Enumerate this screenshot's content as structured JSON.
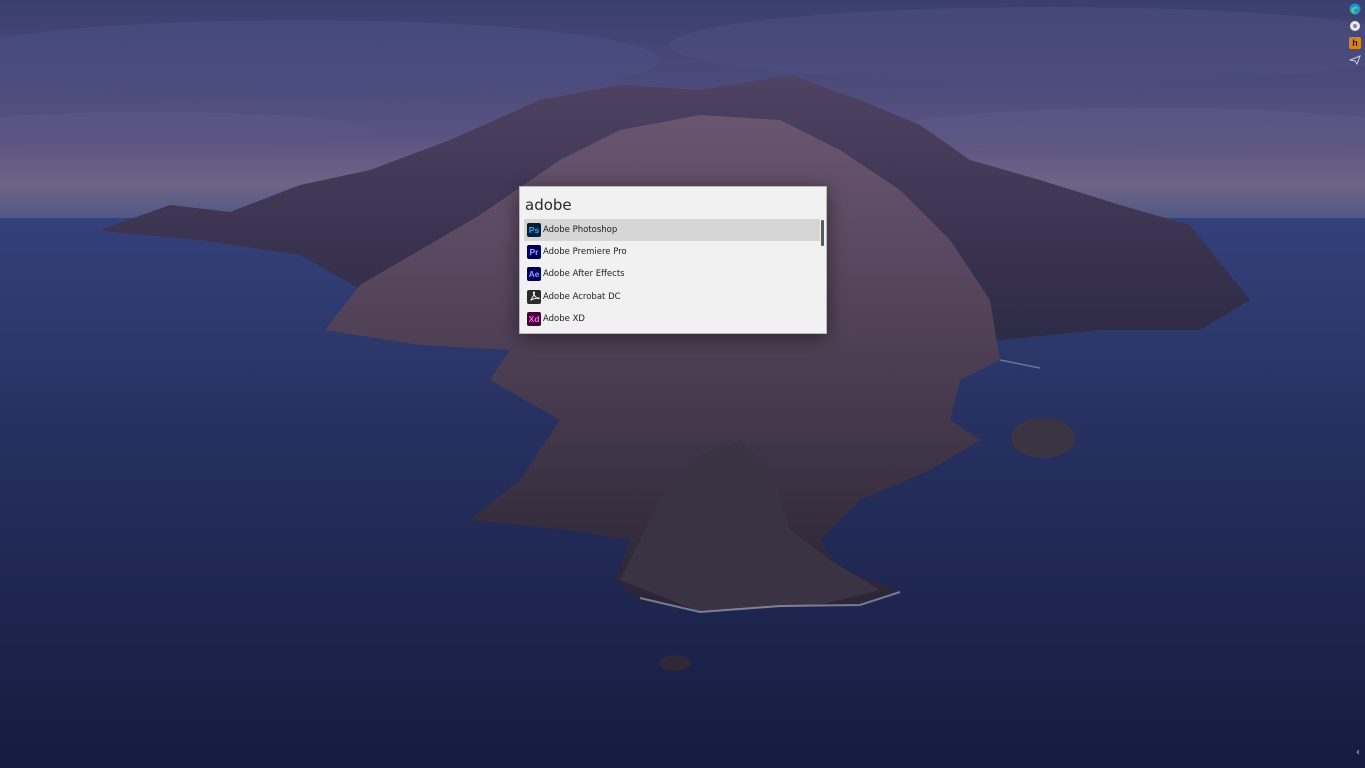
{
  "launcher": {
    "query": "adobe",
    "results": [
      {
        "label": "Adobe Photoshop",
        "icon": "photoshop-icon",
        "icon_text": "Ps",
        "icon_bg": "#001e36",
        "icon_fg": "#31a8ff",
        "selected": true
      },
      {
        "label": "Adobe Premiere Pro",
        "icon": "premiere-pro-icon",
        "icon_text": "Pr",
        "icon_bg": "#00005b",
        "icon_fg": "#9999ff",
        "selected": false
      },
      {
        "label": "Adobe After Effects",
        "icon": "after-effects-icon",
        "icon_text": "Ae",
        "icon_bg": "#00005b",
        "icon_fg": "#9999ff",
        "selected": false
      },
      {
        "label": "Adobe Acrobat DC",
        "icon": "acrobat-icon",
        "icon_text": "",
        "icon_bg": "#2b2b2b",
        "icon_fg": "#ffffff",
        "selected": false
      },
      {
        "label": "Adobe XD",
        "icon": "xd-icon",
        "icon_text": "Xd",
        "icon_bg": "#470137",
        "icon_fg": "#ff61f6",
        "selected": false
      }
    ]
  },
  "tray": {
    "icons": [
      "edge-icon",
      "settings-icon",
      "app-h-icon",
      "network-icon"
    ],
    "h_icon_text": "h",
    "chevron": "‹"
  }
}
